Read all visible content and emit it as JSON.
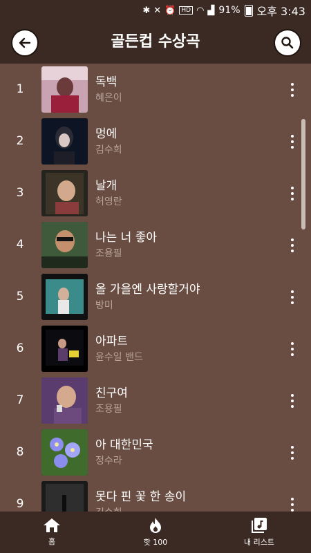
{
  "status": {
    "battery": "91%",
    "time": "오후 3:43",
    "hd_label": "HD"
  },
  "header": {
    "title": "골든컵 수상곡"
  },
  "songs": [
    {
      "rank": "1",
      "title": "독백",
      "artist": "혜은이"
    },
    {
      "rank": "2",
      "title": "멍에",
      "artist": "김수희"
    },
    {
      "rank": "3",
      "title": "날개",
      "artist": "허영란"
    },
    {
      "rank": "4",
      "title": "나는 너 좋아",
      "artist": "조용필"
    },
    {
      "rank": "5",
      "title": "올 가을엔 사랑할거야",
      "artist": "방미"
    },
    {
      "rank": "6",
      "title": "아파트",
      "artist": "윤수일 밴드"
    },
    {
      "rank": "7",
      "title": "친구여",
      "artist": "조용필"
    },
    {
      "rank": "8",
      "title": "아 대한민국",
      "artist": "정수라"
    },
    {
      "rank": "9",
      "title": "못다 핀 꽃 한 송이",
      "artist": "김수희"
    }
  ],
  "nav": {
    "home": "홈",
    "hot": "핫 100",
    "mylist": "내 리스트"
  },
  "colors": {
    "header_bg": "#3b2a23",
    "list_bg": "#6a4d42",
    "artist_text": "#b6a39b"
  }
}
